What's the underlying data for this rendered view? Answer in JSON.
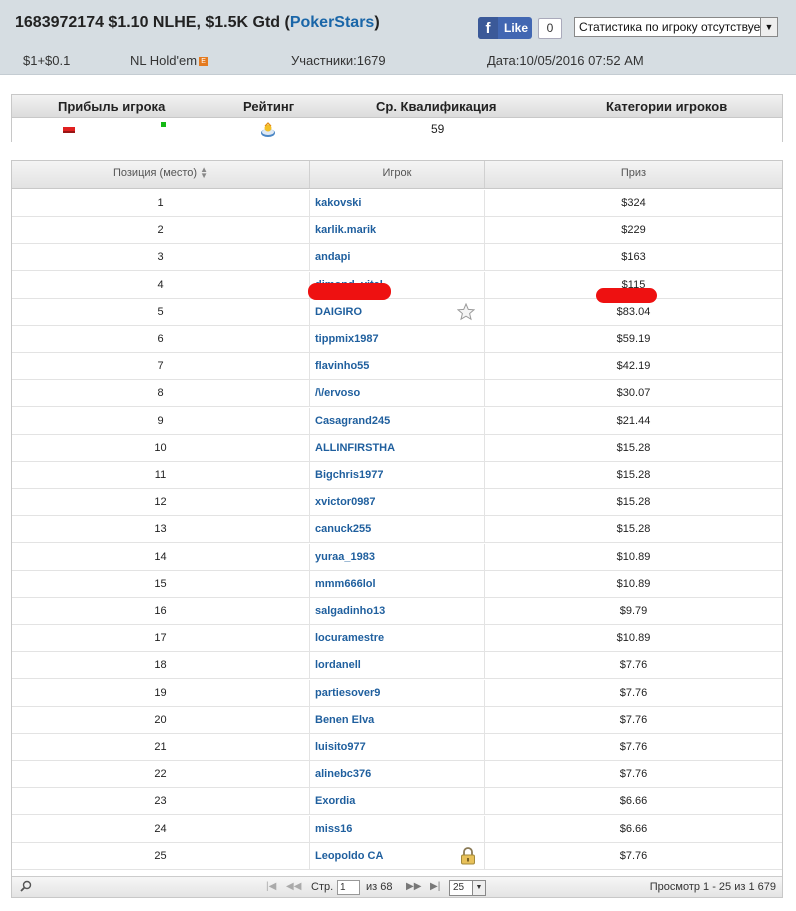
{
  "header": {
    "tournament_id": "1683972174",
    "title_rest": " $1.10 NLHE, $1.5K Gtd (",
    "room": "PokerStars",
    "title_close": ")",
    "like_label": "Like",
    "like_count": "0",
    "stats_select": "Статистика по игроку отсутствует",
    "buyin": "$1+$0.1",
    "game": "NL Hold'em",
    "game_icon": "E",
    "participants": "Участники:1679",
    "date": "Дата:10/05/2016 07:52 AM"
  },
  "summary": {
    "headers": [
      "Прибыль игрока",
      "Рейтинг",
      "Ср. Квалификация",
      "Категории игроков"
    ],
    "avg_qualification": "59"
  },
  "grid": {
    "headers": {
      "position": "Позиция (место)",
      "player": "Игрок",
      "prize": "Приз"
    },
    "rows": [
      {
        "pos": "1",
        "player": "kakovski",
        "prize": "$324"
      },
      {
        "pos": "2",
        "player": "karlik.marik",
        "prize": "$229"
      },
      {
        "pos": "3",
        "player": "andapi",
        "prize": "$163"
      },
      {
        "pos": "4",
        "player": "dimond_vital",
        "prize": "$115"
      },
      {
        "pos": "5",
        "player": "DAIGIRO",
        "prize": "$83.04"
      },
      {
        "pos": "6",
        "player": "tippmix1987",
        "prize": "$59.19"
      },
      {
        "pos": "7",
        "player": "flavinho55",
        "prize": "$42.19"
      },
      {
        "pos": "8",
        "player": "/\\/ervoso",
        "prize": "$30.07"
      },
      {
        "pos": "9",
        "player": "Casagrand245",
        "prize": "$21.44"
      },
      {
        "pos": "10",
        "player": "ALLINFIRSTHA",
        "prize": "$15.28"
      },
      {
        "pos": "11",
        "player": "Bigchris1977",
        "prize": "$15.28"
      },
      {
        "pos": "12",
        "player": "xvictor0987",
        "prize": "$15.28"
      },
      {
        "pos": "13",
        "player": "canuck255",
        "prize": "$15.28"
      },
      {
        "pos": "14",
        "player": "yuraa_1983",
        "prize": "$10.89"
      },
      {
        "pos": "15",
        "player": "mmm666lol",
        "prize": "$10.89"
      },
      {
        "pos": "16",
        "player": "salgadinho13",
        "prize": "$9.79"
      },
      {
        "pos": "17",
        "player": "locuramestre",
        "prize": "$10.89"
      },
      {
        "pos": "18",
        "player": "lordanell",
        "prize": "$7.76"
      },
      {
        "pos": "19",
        "player": "partiesover9",
        "prize": "$7.76"
      },
      {
        "pos": "20",
        "player": "Benen Elva",
        "prize": "$7.76"
      },
      {
        "pos": "21",
        "player": "luisito977",
        "prize": "$7.76"
      },
      {
        "pos": "22",
        "player": "alinebc376",
        "prize": "$7.76"
      },
      {
        "pos": "23",
        "player": "Exordia",
        "prize": "$6.66"
      },
      {
        "pos": "24",
        "player": "miss16",
        "prize": "$6.66"
      },
      {
        "pos": "25",
        "player": "Leopoldo CA",
        "prize": "$7.76"
      }
    ],
    "row_icons": {
      "5": "star-icon",
      "25": "lock-icon"
    }
  },
  "pager": {
    "page_label": "Стр.",
    "page_value": "1",
    "of_label": "из 68",
    "page_size": "25",
    "view_info": "Просмотр 1 - 25 из 1 679"
  },
  "colors": {
    "link": "#1f5f9e",
    "room": "#1a66a8",
    "redaction": "#ee1111",
    "header_bg": "#d6dde2"
  }
}
